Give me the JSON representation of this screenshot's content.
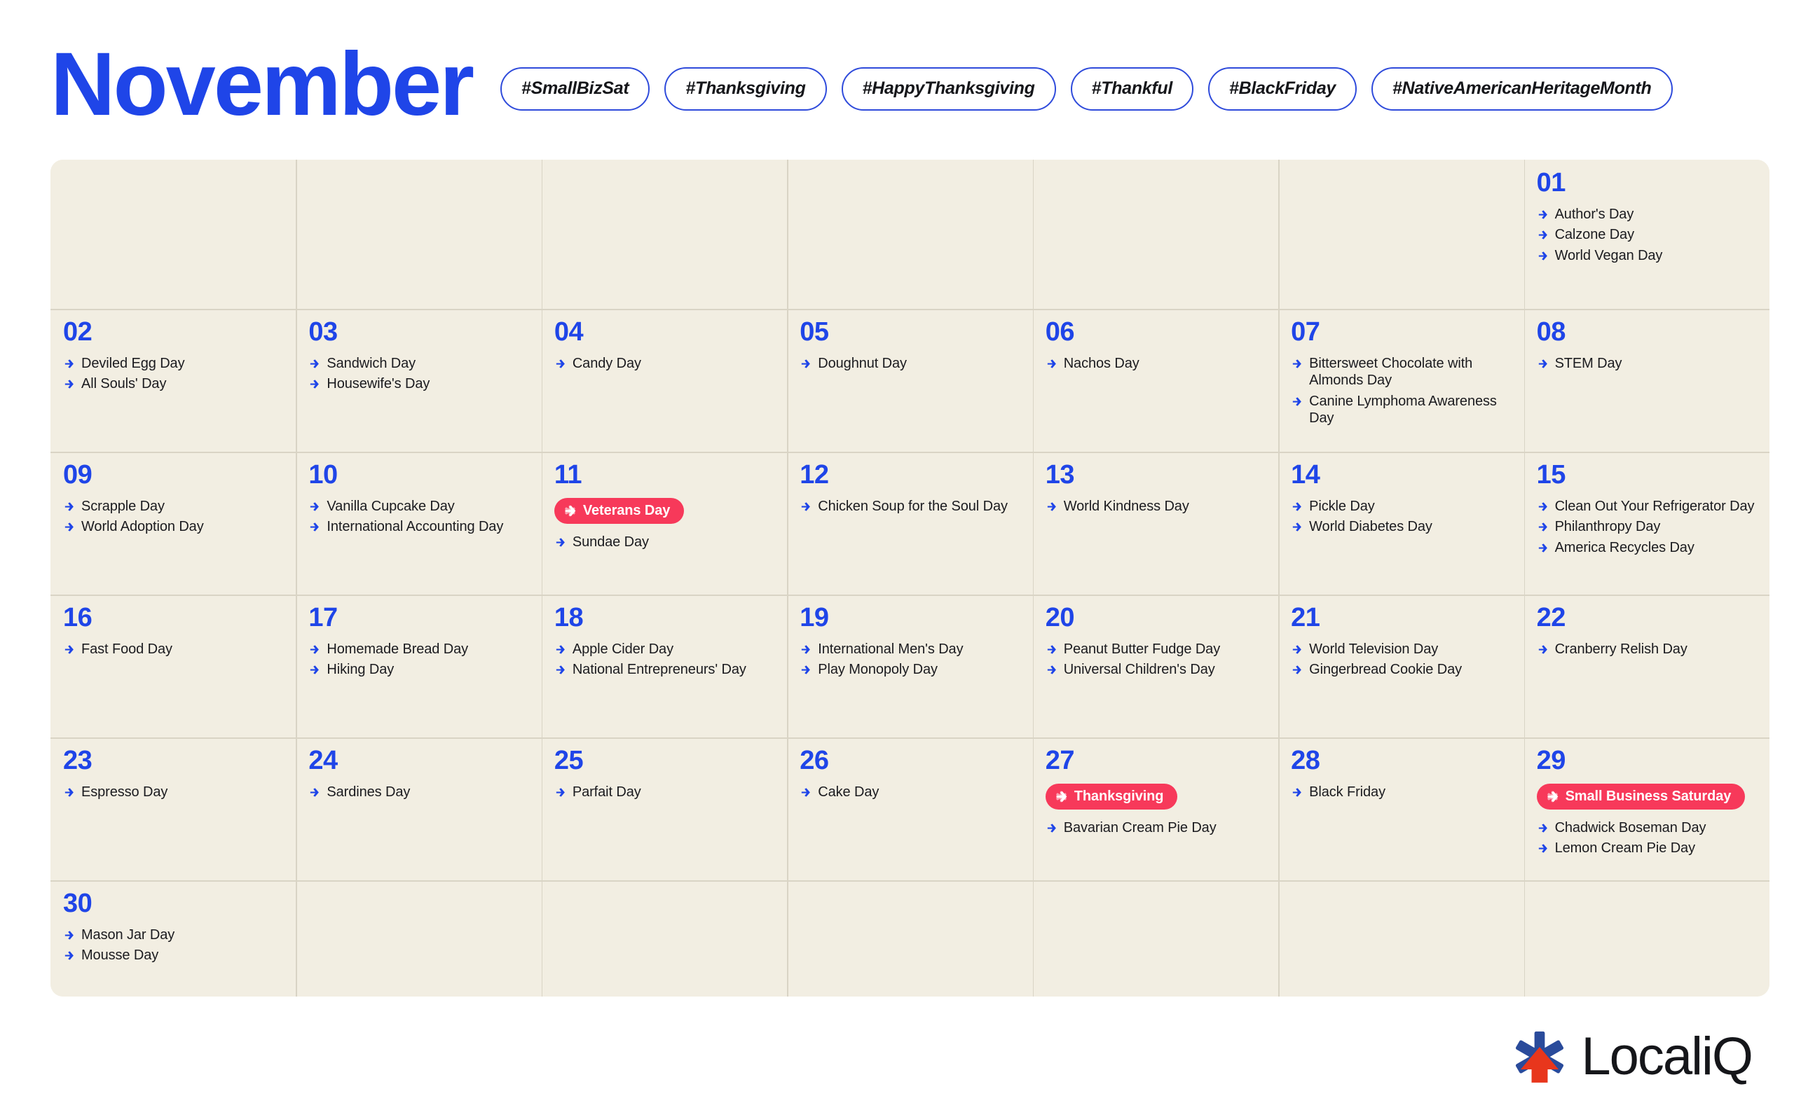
{
  "header": {
    "month_title": "November",
    "hashtags": [
      "#SmallBizSat",
      "#Thanksgiving",
      "#HappyThanksgiving",
      "#Thankful",
      "#BlackFriday",
      "#NativeAmericanHeritageMonth"
    ]
  },
  "colors": {
    "brand_blue": "#1f45e8",
    "pill_border": "#2f4bdb",
    "badge_red": "#f7395a",
    "calendar_bg": "#f2eee2",
    "grid_line": "#d9d4c5",
    "text_dark": "#1b1b1f",
    "logo_blue": "#2a4b9b",
    "logo_red": "#e8361c"
  },
  "calendar": {
    "leading_blanks": 6,
    "days": [
      {
        "number": "01",
        "badge": null,
        "events": [
          "Author's Day",
          "Calzone Day",
          "World Vegan Day"
        ]
      },
      {
        "number": "02",
        "badge": null,
        "events": [
          "Deviled Egg Day",
          "All Souls' Day"
        ]
      },
      {
        "number": "03",
        "badge": null,
        "events": [
          "Sandwich Day",
          "Housewife's Day"
        ]
      },
      {
        "number": "04",
        "badge": null,
        "events": [
          "Candy Day"
        ]
      },
      {
        "number": "05",
        "badge": null,
        "events": [
          "Doughnut Day"
        ]
      },
      {
        "number": "06",
        "badge": null,
        "events": [
          "Nachos Day"
        ]
      },
      {
        "number": "07",
        "badge": null,
        "events": [
          "Bittersweet Chocolate with Almonds Day",
          "Canine Lymphoma Awareness Day"
        ]
      },
      {
        "number": "08",
        "badge": null,
        "events": [
          "STEM Day"
        ]
      },
      {
        "number": "09",
        "badge": null,
        "events": [
          "Scrapple Day",
          "World Adoption Day"
        ]
      },
      {
        "number": "10",
        "badge": null,
        "events": [
          "Vanilla Cupcake Day",
          "International Accounting Day"
        ]
      },
      {
        "number": "11",
        "badge": "Veterans Day",
        "events": [
          "Sundae Day"
        ]
      },
      {
        "number": "12",
        "badge": null,
        "events": [
          "Chicken Soup for the Soul Day"
        ]
      },
      {
        "number": "13",
        "badge": null,
        "events": [
          "World Kindness Day"
        ]
      },
      {
        "number": "14",
        "badge": null,
        "events": [
          "Pickle Day",
          "World Diabetes Day"
        ]
      },
      {
        "number": "15",
        "badge": null,
        "events": [
          "Clean Out Your Refrigerator Day",
          "Philanthropy Day",
          "America Recycles Day"
        ]
      },
      {
        "number": "16",
        "badge": null,
        "events": [
          "Fast Food Day"
        ]
      },
      {
        "number": "17",
        "badge": null,
        "events": [
          "Homemade Bread Day",
          "Hiking Day"
        ]
      },
      {
        "number": "18",
        "badge": null,
        "events": [
          "Apple Cider Day",
          "National Entrepreneurs' Day"
        ]
      },
      {
        "number": "19",
        "badge": null,
        "events": [
          "International Men's Day",
          "Play Monopoly Day"
        ]
      },
      {
        "number": "20",
        "badge": null,
        "events": [
          "Peanut Butter Fudge Day",
          "Universal Children's Day"
        ]
      },
      {
        "number": "21",
        "badge": null,
        "events": [
          "World Television Day",
          "Gingerbread Cookie Day"
        ]
      },
      {
        "number": "22",
        "badge": null,
        "events": [
          "Cranberry Relish Day"
        ]
      },
      {
        "number": "23",
        "badge": null,
        "events": [
          "Espresso Day"
        ]
      },
      {
        "number": "24",
        "badge": null,
        "events": [
          "Sardines Day"
        ]
      },
      {
        "number": "25",
        "badge": null,
        "events": [
          "Parfait Day"
        ]
      },
      {
        "number": "26",
        "badge": null,
        "events": [
          "Cake Day"
        ]
      },
      {
        "number": "27",
        "badge": "Thanksgiving",
        "events": [
          "Bavarian Cream Pie Day"
        ]
      },
      {
        "number": "28",
        "badge": null,
        "events": [
          "Black Friday"
        ]
      },
      {
        "number": "29",
        "badge": "Small Business Saturday",
        "events": [
          "Chadwick Boseman Day",
          "Lemon Cream Pie Day"
        ]
      },
      {
        "number": "30",
        "badge": null,
        "events": [
          "Mason Jar Day",
          "Mousse Day"
        ]
      }
    ]
  },
  "footer": {
    "logo_text": "LocaliQ",
    "logo_mark": "asterisk-arrow-icon"
  }
}
